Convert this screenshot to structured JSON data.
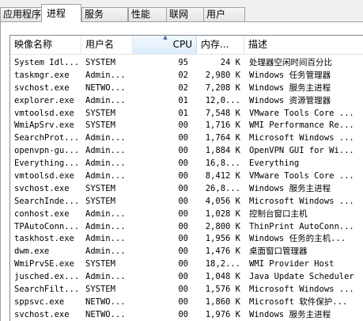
{
  "tabs": [
    {
      "label": "应用程序",
      "active": false
    },
    {
      "label": "进程",
      "active": true
    },
    {
      "label": "服务",
      "active": false
    },
    {
      "label": "性能",
      "active": false
    },
    {
      "label": "联网",
      "active": false
    },
    {
      "label": "用户",
      "active": false
    }
  ],
  "columns": {
    "name": "映像名称",
    "user": "用户名",
    "cpu": "CPU",
    "mem": "内存...",
    "desc": "描述"
  },
  "processes": [
    {
      "name": "System Idl...",
      "user": "SYSTEM",
      "cpu": "95",
      "mem": "24 K",
      "desc": "处理器空闲时间百分比"
    },
    {
      "name": "taskmgr.exe",
      "user": "Admin...",
      "cpu": "02",
      "mem": "2,980 K",
      "desc": "Windows 任务管理器"
    },
    {
      "name": "svchost.exe",
      "user": "NETWO...",
      "cpu": "02",
      "mem": "7,208 K",
      "desc": "Windows 服务主进程"
    },
    {
      "name": "explorer.exe",
      "user": "Admin...",
      "cpu": "01",
      "mem": "12,0...",
      "desc": "Windows 资源管理器"
    },
    {
      "name": "vmtoolsd.exe",
      "user": "SYSTEM",
      "cpu": "01",
      "mem": "7,548 K",
      "desc": "VMware Tools Core ..."
    },
    {
      "name": "WmiApSrv.exe",
      "user": "SYSTEM",
      "cpu": "00",
      "mem": "1,716 K",
      "desc": "WMI Performance Re..."
    },
    {
      "name": "SearchProt...",
      "user": "Admin...",
      "cpu": "00",
      "mem": "1,764 K",
      "desc": "Microsoft Windows ..."
    },
    {
      "name": "openvpn-gu...",
      "user": "Admin...",
      "cpu": "00",
      "mem": "1,884 K",
      "desc": "OpenVPN GUI for Wi..."
    },
    {
      "name": "Everything...",
      "user": "Admin...",
      "cpu": "00",
      "mem": "16,8...",
      "desc": "Everything"
    },
    {
      "name": "vmtoolsd.exe",
      "user": "Admin...",
      "cpu": "00",
      "mem": "8,412 K",
      "desc": "VMware Tools Core ..."
    },
    {
      "name": "svchost.exe",
      "user": "SYSTEM",
      "cpu": "00",
      "mem": "26,8...",
      "desc": "Windows 服务主进程"
    },
    {
      "name": "SearchInde...",
      "user": "SYSTEM",
      "cpu": "00",
      "mem": "4,056 K",
      "desc": "Microsoft Windows ..."
    },
    {
      "name": "conhost.exe",
      "user": "Admin...",
      "cpu": "00",
      "mem": "1,028 K",
      "desc": "控制台窗口主机"
    },
    {
      "name": "TPAutoConn...",
      "user": "Admin...",
      "cpu": "00",
      "mem": "2,800 K",
      "desc": "ThinPrint AutoConn..."
    },
    {
      "name": "taskhost.exe",
      "user": "Admin...",
      "cpu": "00",
      "mem": "1,956 K",
      "desc": "Windows 任务的主机..."
    },
    {
      "name": "dwm.exe",
      "user": "Admin...",
      "cpu": "00",
      "mem": "1,476 K",
      "desc": "桌面窗口管理器"
    },
    {
      "name": "WmiPrvSE.exe",
      "user": "SYSTEM",
      "cpu": "00",
      "mem": "18,2...",
      "desc": "WMI Provider Host"
    },
    {
      "name": "jusched.ex...",
      "user": "Admin...",
      "cpu": "00",
      "mem": "1,048 K",
      "desc": "Java Update Scheduler"
    },
    {
      "name": "SearchFilt...",
      "user": "SYSTEM",
      "cpu": "00",
      "mem": "1,576 K",
      "desc": "Microsoft Windows ..."
    },
    {
      "name": "sppsvc.exe",
      "user": "NETWO...",
      "cpu": "00",
      "mem": "1,860 K",
      "desc": "Microsoft 软件保护..."
    },
    {
      "name": "svchost.exe",
      "user": "NETWO...",
      "cpu": "00",
      "mem": "1,976 K",
      "desc": "Windows 服务主进程"
    }
  ],
  "sort": {
    "column": "cpu",
    "direction": "descending",
    "indicator": "▲"
  }
}
